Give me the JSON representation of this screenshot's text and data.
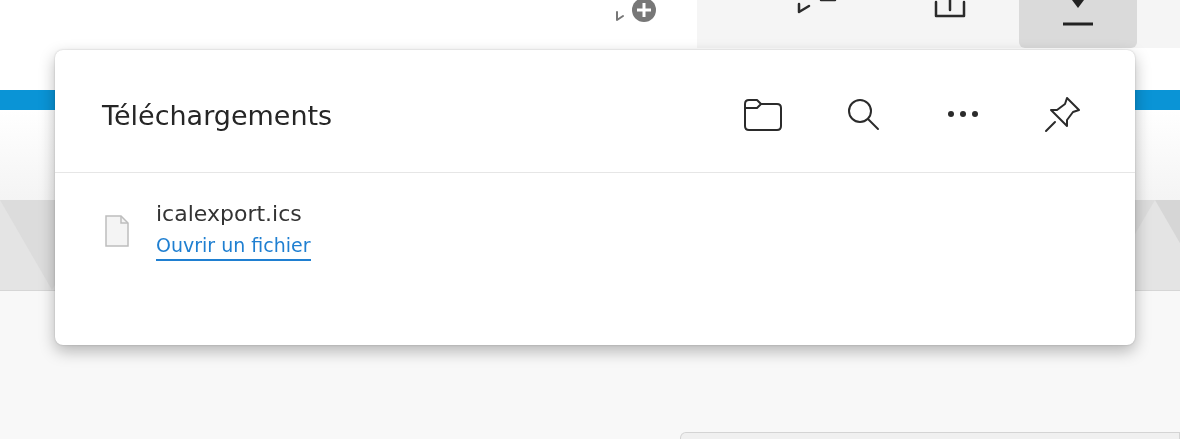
{
  "toolbar_buttons": [
    {
      "selected": false
    },
    {
      "selected": false
    },
    {
      "selected": true
    }
  ],
  "downloads_panel": {
    "title": "Téléchargements",
    "items": [
      {
        "file_name": "icalexport.ics",
        "action": "Ouvrir un fichier"
      }
    ]
  }
}
